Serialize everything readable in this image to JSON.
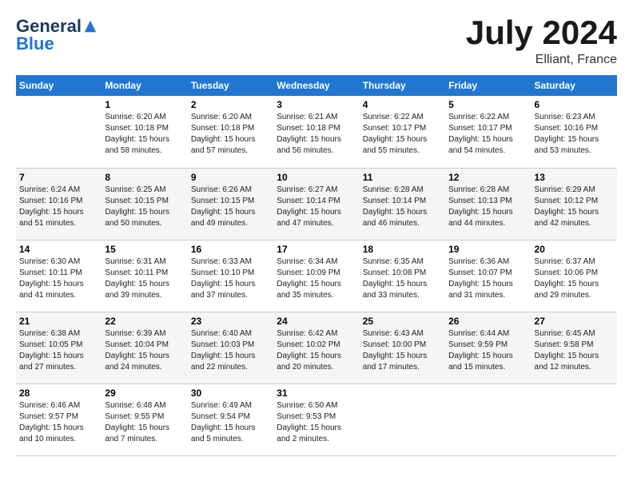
{
  "header": {
    "logo_general": "General",
    "logo_blue": "Blue",
    "month_year": "July 2024",
    "location": "Elliant, France"
  },
  "calendar": {
    "days_of_week": [
      "Sunday",
      "Monday",
      "Tuesday",
      "Wednesday",
      "Thursday",
      "Friday",
      "Saturday"
    ],
    "weeks": [
      [
        {
          "day": "",
          "sunrise": "",
          "sunset": "",
          "daylight": ""
        },
        {
          "day": "1",
          "sunrise": "Sunrise: 6:20 AM",
          "sunset": "Sunset: 10:18 PM",
          "daylight": "Daylight: 15 hours and 58 minutes."
        },
        {
          "day": "2",
          "sunrise": "Sunrise: 6:20 AM",
          "sunset": "Sunset: 10:18 PM",
          "daylight": "Daylight: 15 hours and 57 minutes."
        },
        {
          "day": "3",
          "sunrise": "Sunrise: 6:21 AM",
          "sunset": "Sunset: 10:18 PM",
          "daylight": "Daylight: 15 hours and 56 minutes."
        },
        {
          "day": "4",
          "sunrise": "Sunrise: 6:22 AM",
          "sunset": "Sunset: 10:17 PM",
          "daylight": "Daylight: 15 hours and 55 minutes."
        },
        {
          "day": "5",
          "sunrise": "Sunrise: 6:22 AM",
          "sunset": "Sunset: 10:17 PM",
          "daylight": "Daylight: 15 hours and 54 minutes."
        },
        {
          "day": "6",
          "sunrise": "Sunrise: 6:23 AM",
          "sunset": "Sunset: 10:16 PM",
          "daylight": "Daylight: 15 hours and 53 minutes."
        }
      ],
      [
        {
          "day": "7",
          "sunrise": "Sunrise: 6:24 AM",
          "sunset": "Sunset: 10:16 PM",
          "daylight": "Daylight: 15 hours and 51 minutes."
        },
        {
          "day": "8",
          "sunrise": "Sunrise: 6:25 AM",
          "sunset": "Sunset: 10:15 PM",
          "daylight": "Daylight: 15 hours and 50 minutes."
        },
        {
          "day": "9",
          "sunrise": "Sunrise: 6:26 AM",
          "sunset": "Sunset: 10:15 PM",
          "daylight": "Daylight: 15 hours and 49 minutes."
        },
        {
          "day": "10",
          "sunrise": "Sunrise: 6:27 AM",
          "sunset": "Sunset: 10:14 PM",
          "daylight": "Daylight: 15 hours and 47 minutes."
        },
        {
          "day": "11",
          "sunrise": "Sunrise: 6:28 AM",
          "sunset": "Sunset: 10:14 PM",
          "daylight": "Daylight: 15 hours and 46 minutes."
        },
        {
          "day": "12",
          "sunrise": "Sunrise: 6:28 AM",
          "sunset": "Sunset: 10:13 PM",
          "daylight": "Daylight: 15 hours and 44 minutes."
        },
        {
          "day": "13",
          "sunrise": "Sunrise: 6:29 AM",
          "sunset": "Sunset: 10:12 PM",
          "daylight": "Daylight: 15 hours and 42 minutes."
        }
      ],
      [
        {
          "day": "14",
          "sunrise": "Sunrise: 6:30 AM",
          "sunset": "Sunset: 10:11 PM",
          "daylight": "Daylight: 15 hours and 41 minutes."
        },
        {
          "day": "15",
          "sunrise": "Sunrise: 6:31 AM",
          "sunset": "Sunset: 10:11 PM",
          "daylight": "Daylight: 15 hours and 39 minutes."
        },
        {
          "day": "16",
          "sunrise": "Sunrise: 6:33 AM",
          "sunset": "Sunset: 10:10 PM",
          "daylight": "Daylight: 15 hours and 37 minutes."
        },
        {
          "day": "17",
          "sunrise": "Sunrise: 6:34 AM",
          "sunset": "Sunset: 10:09 PM",
          "daylight": "Daylight: 15 hours and 35 minutes."
        },
        {
          "day": "18",
          "sunrise": "Sunrise: 6:35 AM",
          "sunset": "Sunset: 10:08 PM",
          "daylight": "Daylight: 15 hours and 33 minutes."
        },
        {
          "day": "19",
          "sunrise": "Sunrise: 6:36 AM",
          "sunset": "Sunset: 10:07 PM",
          "daylight": "Daylight: 15 hours and 31 minutes."
        },
        {
          "day": "20",
          "sunrise": "Sunrise: 6:37 AM",
          "sunset": "Sunset: 10:06 PM",
          "daylight": "Daylight: 15 hours and 29 minutes."
        }
      ],
      [
        {
          "day": "21",
          "sunrise": "Sunrise: 6:38 AM",
          "sunset": "Sunset: 10:05 PM",
          "daylight": "Daylight: 15 hours and 27 minutes."
        },
        {
          "day": "22",
          "sunrise": "Sunrise: 6:39 AM",
          "sunset": "Sunset: 10:04 PM",
          "daylight": "Daylight: 15 hours and 24 minutes."
        },
        {
          "day": "23",
          "sunrise": "Sunrise: 6:40 AM",
          "sunset": "Sunset: 10:03 PM",
          "daylight": "Daylight: 15 hours and 22 minutes."
        },
        {
          "day": "24",
          "sunrise": "Sunrise: 6:42 AM",
          "sunset": "Sunset: 10:02 PM",
          "daylight": "Daylight: 15 hours and 20 minutes."
        },
        {
          "day": "25",
          "sunrise": "Sunrise: 6:43 AM",
          "sunset": "Sunset: 10:00 PM",
          "daylight": "Daylight: 15 hours and 17 minutes."
        },
        {
          "day": "26",
          "sunrise": "Sunrise: 6:44 AM",
          "sunset": "Sunset: 9:59 PM",
          "daylight": "Daylight: 15 hours and 15 minutes."
        },
        {
          "day": "27",
          "sunrise": "Sunrise: 6:45 AM",
          "sunset": "Sunset: 9:58 PM",
          "daylight": "Daylight: 15 hours and 12 minutes."
        }
      ],
      [
        {
          "day": "28",
          "sunrise": "Sunrise: 6:46 AM",
          "sunset": "Sunset: 9:57 PM",
          "daylight": "Daylight: 15 hours and 10 minutes."
        },
        {
          "day": "29",
          "sunrise": "Sunrise: 6:48 AM",
          "sunset": "Sunset: 9:55 PM",
          "daylight": "Daylight: 15 hours and 7 minutes."
        },
        {
          "day": "30",
          "sunrise": "Sunrise: 6:49 AM",
          "sunset": "Sunset: 9:54 PM",
          "daylight": "Daylight: 15 hours and 5 minutes."
        },
        {
          "day": "31",
          "sunrise": "Sunrise: 6:50 AM",
          "sunset": "Sunset: 9:53 PM",
          "daylight": "Daylight: 15 hours and 2 minutes."
        },
        {
          "day": "",
          "sunrise": "",
          "sunset": "",
          "daylight": ""
        },
        {
          "day": "",
          "sunrise": "",
          "sunset": "",
          "daylight": ""
        },
        {
          "day": "",
          "sunrise": "",
          "sunset": "",
          "daylight": ""
        }
      ]
    ]
  }
}
